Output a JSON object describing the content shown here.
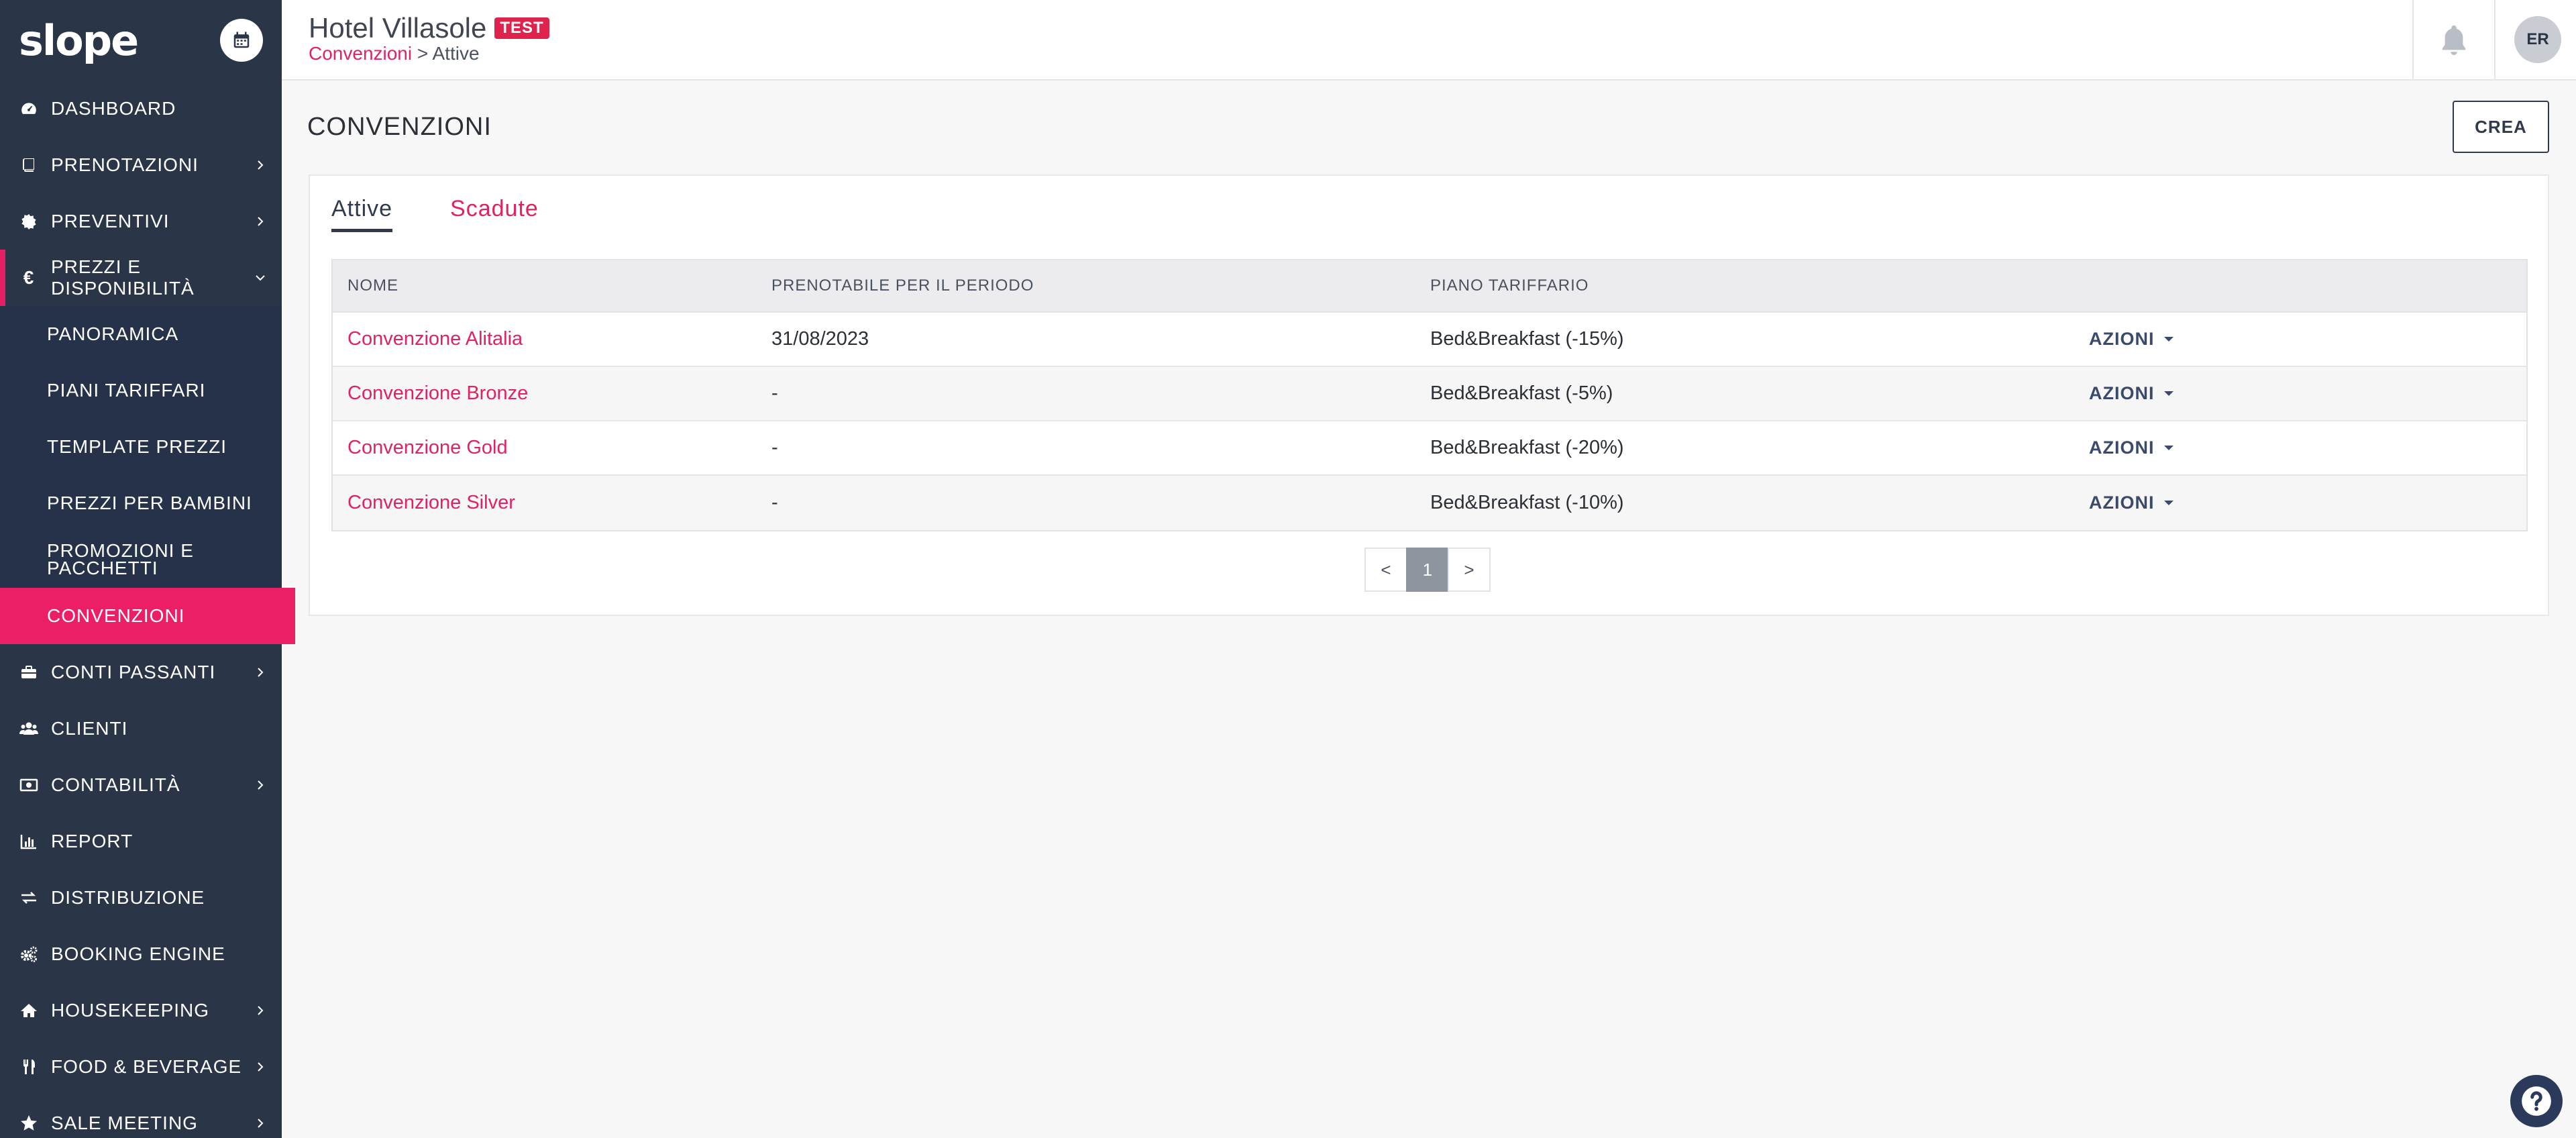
{
  "app": {
    "logo": "slope"
  },
  "sidebar": {
    "items": [
      {
        "label": "DASHBOARD",
        "icon": "dashboard-icon",
        "chevron": false
      },
      {
        "label": "PRENOTAZIONI",
        "icon": "book-icon",
        "chevron": true
      },
      {
        "label": "PREVENTIVI",
        "icon": "gear-badge-icon",
        "chevron": true
      },
      {
        "label": "PREZZI E DISPONIBILITÀ",
        "icon": "euro-icon",
        "chevron": true,
        "expanded": true
      },
      {
        "label": "CONTI PASSANTI",
        "icon": "briefcase-icon",
        "chevron": true
      },
      {
        "label": "CLIENTI",
        "icon": "users-icon",
        "chevron": false
      },
      {
        "label": "CONTABILITÀ",
        "icon": "money-icon",
        "chevron": true
      },
      {
        "label": "REPORT",
        "icon": "bar-chart-icon",
        "chevron": false
      },
      {
        "label": "DISTRIBUZIONE",
        "icon": "exchange-icon",
        "chevron": false
      },
      {
        "label": "BOOKING ENGINE",
        "icon": "cogs-icon",
        "chevron": false
      },
      {
        "label": "HOUSEKEEPING",
        "icon": "home-icon",
        "chevron": true
      },
      {
        "label": "FOOD & BEVERAGE",
        "icon": "cutlery-icon",
        "chevron": true
      },
      {
        "label": "SALE MEETING",
        "icon": "star-icon",
        "chevron": true
      }
    ],
    "subitems": [
      {
        "label": "PANORAMICA"
      },
      {
        "label": "PIANI TARIFFARI"
      },
      {
        "label": "TEMPLATE PREZZI"
      },
      {
        "label": "PREZZI PER BAMBINI"
      },
      {
        "label": "PROMOZIONI E PACCHETTI"
      },
      {
        "label": "CONVENZIONI",
        "active": true
      }
    ]
  },
  "header": {
    "hotel_name": "Hotel Villasole",
    "badge": "TEST",
    "breadcrumb_link": "Convenzioni",
    "breadcrumb_sep": " > ",
    "breadcrumb_current": "Attive",
    "avatar_initials": "ER"
  },
  "main": {
    "page_title": "CONVENZIONI",
    "create_button": "CREA",
    "tabs": [
      {
        "label": "Attive",
        "active": true
      },
      {
        "label": "Scadute",
        "active": false
      }
    ],
    "table": {
      "columns": [
        "NOME",
        "PRENOTABILE PER IL PERIODO",
        "PIANO TARIFFARIO",
        ""
      ],
      "rows": [
        {
          "name": "Convenzione Alitalia",
          "period": "31/08/2023",
          "plan": "Bed&Breakfast (-15%)",
          "action": "AZIONI"
        },
        {
          "name": "Convenzione Bronze",
          "period": "-",
          "plan": "Bed&Breakfast (-5%)",
          "action": "AZIONI"
        },
        {
          "name": "Convenzione Gold",
          "period": "-",
          "plan": "Bed&Breakfast (-20%)",
          "action": "AZIONI"
        },
        {
          "name": "Convenzione Silver",
          "period": "-",
          "plan": "Bed&Breakfast (-10%)",
          "action": "AZIONI"
        }
      ]
    },
    "pagination": {
      "prev": "<",
      "current": "1",
      "next": ">"
    }
  },
  "colors": {
    "sidebar_bg": "#2a3547",
    "accent": "#e61e63",
    "link": "#e0235f",
    "primary_dark": "#2f3a4d"
  }
}
